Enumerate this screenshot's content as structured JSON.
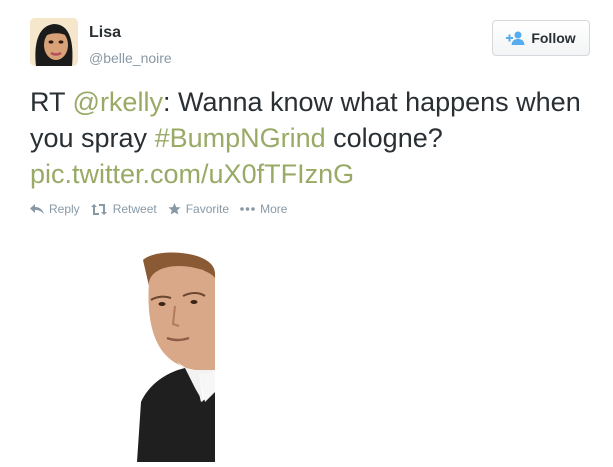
{
  "author": {
    "name": "Lisa",
    "handle": "@belle_noire"
  },
  "follow_button": {
    "label": "Follow",
    "icon": "add-user-icon"
  },
  "tweet": {
    "prefix": "RT ",
    "mention": "@rkelly",
    "text_1": ": Wanna know what happens when you spray ",
    "hashtag": "#BumpNGrind",
    "text_2": " cologne?",
    "pic_link": "pic.twitter.com/uX0fTFIznG"
  },
  "actions": [
    {
      "label": "Reply",
      "icon": "reply-icon"
    },
    {
      "label": "Retweet",
      "icon": "retweet-icon"
    },
    {
      "label": "Favorite",
      "icon": "star-icon"
    },
    {
      "label": "More",
      "icon": "more-icon"
    }
  ],
  "colors": {
    "link": "#99aa66",
    "muted": "#8899a6",
    "text": "#292f33"
  }
}
